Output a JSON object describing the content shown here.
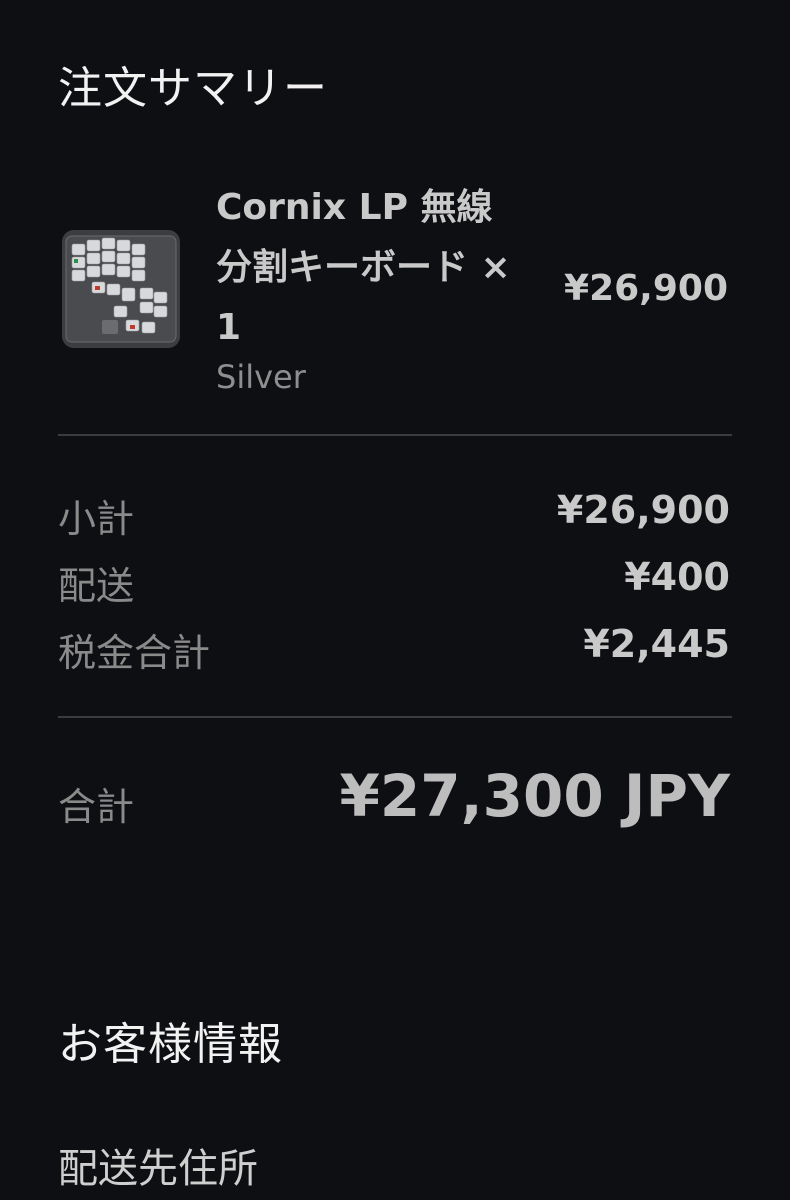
{
  "order_summary": {
    "title": "注文サマリー",
    "product": {
      "name": "Cornix LP 無線分割キーボード × 1",
      "variant": "Silver",
      "price": "¥26,900",
      "image_icon": "split-keyboard-thumbnail"
    },
    "rows": [
      {
        "label": "小計",
        "value": "¥26,900"
      },
      {
        "label": "配送",
        "value": "¥400"
      },
      {
        "label": "税金合計",
        "value": "¥2,445"
      }
    ],
    "total": {
      "label": "合計",
      "value": "¥27,300 JPY"
    }
  },
  "customer_info": {
    "title": "お客様情報",
    "shipping_address_label": "配送先住所"
  },
  "colors": {
    "background": "#0e0f13",
    "divider": "#3b3c40",
    "text_primary": "#f2f2f2",
    "text_secondary": "#8a8a8a"
  }
}
